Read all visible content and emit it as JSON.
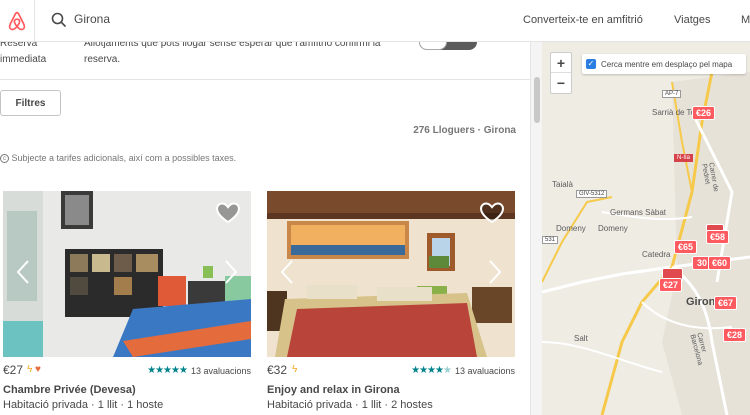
{
  "header": {
    "search_value": "Girona",
    "nav": [
      "Converteix-te en amfitrió",
      "Viatges",
      "M"
    ]
  },
  "list": {
    "instant_book_label": [
      "Reserva",
      "immediata"
    ],
    "instant_book_desc": "Allotjaments que pots llogar sense esperar que l'amfitrió confirmi la reserva.",
    "filters_button": "Filtres",
    "results": "276 Lloguers · Girona",
    "notice": "Subjecte a tarifes adicionals, així com a possibles taxes.",
    "cards": [
      {
        "price": "€27",
        "rating": 5,
        "reviews": "13 avaluacions",
        "title": "Chambre Privée (Devesa)",
        "subtitle": "Habitació privada · 1 llit · 1 hoste"
      },
      {
        "price": "€32",
        "rating": 4.5,
        "reviews": "13 avaluacions",
        "title": "Enjoy and relax in Girona",
        "subtitle": "Habitació privada · 1 llit · 2 hostes"
      }
    ]
  },
  "map": {
    "zoom_in": "+",
    "zoom_out": "−",
    "search_on_move": "Cerca mentre em desplaço pel mapa",
    "places": [
      "Sarrià de Ter",
      "Taialà",
      "Germans Sàbat",
      "Domeny",
      "Domeny",
      "Catedra",
      "Giron",
      "Salt",
      "Carrer de Pedret",
      "Carrer Barcelona"
    ],
    "roads": [
      "AP-7",
      "N-IIa",
      "GIV-5312",
      "531"
    ],
    "pins": [
      "€26",
      "€58",
      "€65",
      "30",
      "€60",
      "€27",
      "€67",
      "€28"
    ],
    "colors": {
      "accent": "#ff5a5f",
      "teal": "#008489",
      "amber": "#f5a623"
    }
  }
}
